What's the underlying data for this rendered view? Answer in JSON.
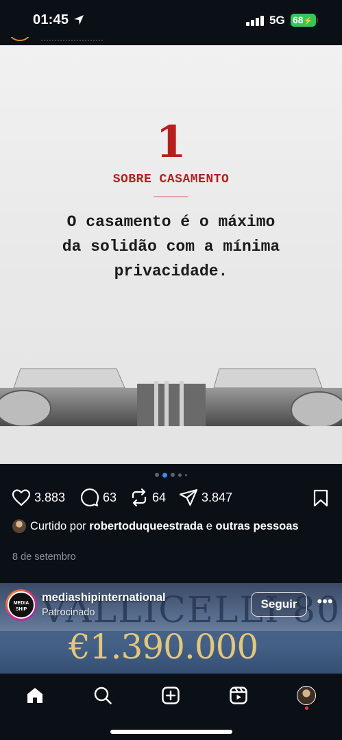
{
  "status_bar": {
    "time": "01:45",
    "network": "5G",
    "battery": "68"
  },
  "post": {
    "image": {
      "number": "1",
      "heading": "SOBRE CASAMENTO",
      "quote_lines": [
        "O casamento é o máximo",
        "da solidão com a mínima",
        "privacidade."
      ]
    },
    "carousel": {
      "count": 5,
      "active": 1
    },
    "actions": {
      "likes": "3.883",
      "comments": "63",
      "reposts": "64",
      "shares": "3.847"
    },
    "liked_by": {
      "prefix": "Curtido por",
      "user": "robertoduqueestrada",
      "conjunction": "e",
      "others": "outras pessoas"
    },
    "date": "8 de setembro"
  },
  "sponsored_post": {
    "username": "mediashipinternational",
    "label": "Patrocinado",
    "follow_label": "Seguir",
    "avatar_text": "MEDIA SHIP",
    "ad_headline": "VALLICELLI 80",
    "ad_price": "€1.390.000"
  },
  "icons": [
    "location-arrow-icon",
    "signal-icon",
    "heart-icon",
    "comment-icon",
    "repost-icon",
    "send-icon",
    "bookmark-icon",
    "more-icon",
    "home-icon",
    "search-icon",
    "create-icon",
    "reels-icon",
    "profile-avatar"
  ],
  "colors": {
    "background": "#0b1016",
    "quote_red": "#b71f1f",
    "battery_green": "#33c759",
    "carousel_active": "#3d8af7",
    "ad_price_gold": "#e3c77b"
  }
}
